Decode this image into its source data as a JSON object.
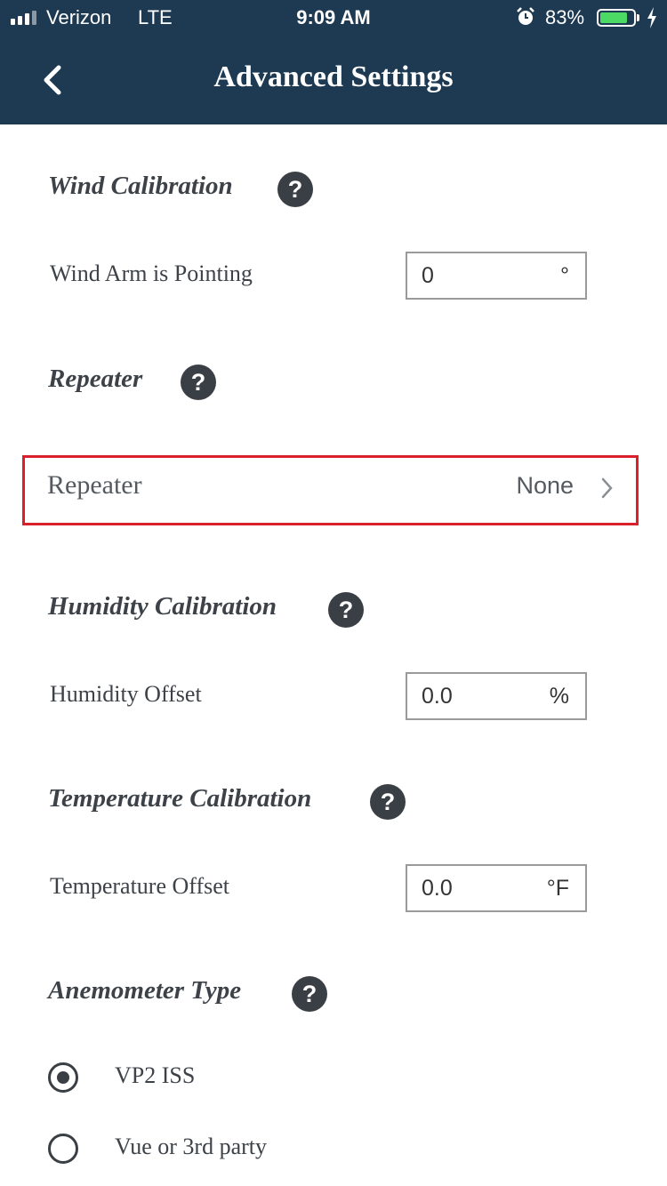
{
  "status_bar": {
    "carrier": "Verizon",
    "network": "LTE",
    "time": "9:09 AM",
    "battery_percent": "83%",
    "battery_level": 0.83,
    "battery_color": "#4cd964",
    "alarm_icon": "alarm-clock-icon",
    "charging_icon": "lightning-bolt-icon"
  },
  "header": {
    "title": "Advanced Settings",
    "back_icon": "chevron-left-icon",
    "background": "#1d3a52"
  },
  "wind_calibration": {
    "title": "Wind Calibration",
    "help": "?",
    "row_label": "Wind Arm is Pointing",
    "value": "0",
    "unit": "°"
  },
  "repeater": {
    "title": "Repeater",
    "help": "?",
    "row_label": "Repeater",
    "value": "None",
    "highlight_color": "#d9202c"
  },
  "humidity_calibration": {
    "title": "Humidity Calibration",
    "help": "?",
    "row_label": "Humidity Offset",
    "value": "0.0",
    "unit": "%"
  },
  "temperature_calibration": {
    "title": "Temperature Calibration",
    "help": "?",
    "row_label": "Temperature Offset",
    "value": "0.0",
    "unit": "°F"
  },
  "anemometer_type": {
    "title": "Anemometer Type",
    "help": "?",
    "options": [
      {
        "label": "VP2 ISS",
        "selected": true
      },
      {
        "label": "Vue or 3rd party",
        "selected": false
      }
    ]
  }
}
